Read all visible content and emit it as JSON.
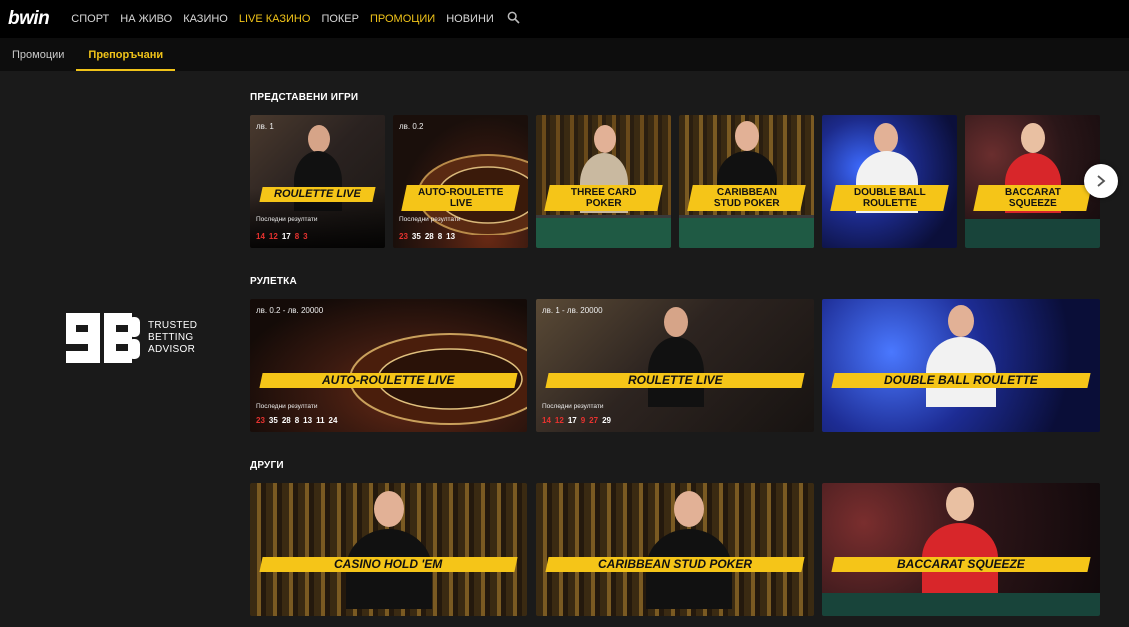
{
  "header": {
    "logo": "bwin",
    "nav": [
      {
        "label": "СПОРТ",
        "gold": false
      },
      {
        "label": "НА ЖИВО",
        "gold": false
      },
      {
        "label": "КАЗИНО",
        "gold": false
      },
      {
        "label": "LIVE КАЗИНО",
        "gold": true
      },
      {
        "label": "ПОКЕР",
        "gold": false
      },
      {
        "label": "ПРОМОЦИИ",
        "gold": true
      },
      {
        "label": "НОВИНИ",
        "gold": false
      }
    ],
    "search_icon": "search-icon"
  },
  "subnav": {
    "tabs": [
      {
        "label": "Промоции",
        "active": false
      },
      {
        "label": "Препоръчани",
        "active": true
      }
    ]
  },
  "sidebar": {
    "badge_text_1": "TRUSTED",
    "badge_text_2": "BETTING",
    "badge_text_3": "ADVISOR"
  },
  "sections": {
    "featured": {
      "title": "ПРЕДСТАВЕНИ ИГРИ",
      "games": [
        {
          "name_1": "ROULETTE LIVE",
          "name_2": "",
          "limit": "лв. 1",
          "res_label": "Последни резултати",
          "results": [
            [
              "14",
              "r"
            ],
            [
              "12",
              "r"
            ],
            [
              "17",
              "b"
            ],
            [
              "8",
              "r"
            ],
            [
              "3",
              "r"
            ]
          ]
        },
        {
          "name_1": "AUTO-ROULETTE",
          "name_2": "LIVE",
          "limit": "лв. 0.2",
          "res_label": "Последни резултати",
          "results": [
            [
              "23",
              "r"
            ],
            [
              "35",
              "b"
            ],
            [
              "28",
              "b"
            ],
            [
              "8",
              "b"
            ],
            [
              "13",
              "b"
            ]
          ]
        },
        {
          "name_1": "THREE CARD",
          "name_2": "POKER",
          "limit": "",
          "res_label": "",
          "results": []
        },
        {
          "name_1": "CARIBBEAN",
          "name_2": "STUD POKER",
          "limit": "",
          "res_label": "",
          "results": []
        },
        {
          "name_1": "DOUBLE BALL",
          "name_2": "ROULETTE",
          "limit": "",
          "res_label": "",
          "results": []
        },
        {
          "name_1": "BACCARAT",
          "name_2": "SQUEEZE",
          "limit": "",
          "res_label": "",
          "results": []
        }
      ]
    },
    "roulette": {
      "title": "РУЛЕТКА",
      "games": [
        {
          "name": "AUTO-ROULETTE LIVE",
          "limit": "лв. 0.2 - лв. 20000",
          "res_label": "Последни резултати",
          "results": [
            [
              "23",
              "r"
            ],
            [
              "35",
              "b"
            ],
            [
              "28",
              "b"
            ],
            [
              "8",
              "b"
            ],
            [
              "13",
              "b"
            ],
            [
              "11",
              "b"
            ],
            [
              "24",
              "b"
            ]
          ]
        },
        {
          "name": "ROULETTE LIVE",
          "limit": "лв. 1 - лв. 20000",
          "res_label": "Последни резултати",
          "results": [
            [
              "14",
              "r"
            ],
            [
              "12",
              "r"
            ],
            [
              "17",
              "b"
            ],
            [
              "9",
              "r"
            ],
            [
              "27",
              "r"
            ],
            [
              "29",
              "b"
            ]
          ]
        },
        {
          "name": "DOUBLE BALL ROULETTE",
          "limit": "",
          "res_label": "",
          "results": []
        }
      ]
    },
    "other": {
      "title": "ДРУГИ",
      "games": [
        {
          "name": "CASINO HOLD 'EM"
        },
        {
          "name": "CARIBBEAN STUD POKER"
        },
        {
          "name": "BACCARAT SQUEEZE"
        }
      ]
    }
  },
  "colors": {
    "accent": "#f5c518",
    "nav_gold": "#f0c319",
    "red_number": "#e8322f"
  }
}
